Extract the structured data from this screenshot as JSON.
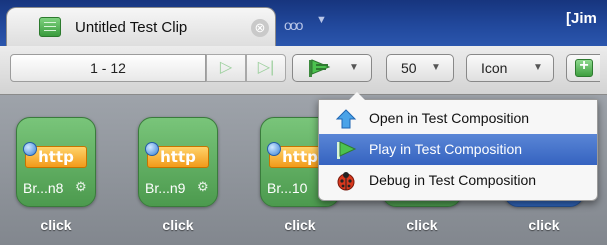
{
  "titlebar": {
    "tab_title": "Untitled Test Clip",
    "close_glyph": "⊗",
    "more_glyph": "ooo",
    "more_arrow": "▼",
    "user": "[Jim"
  },
  "toolbar": {
    "range": "1 - 12",
    "play_glyph": "▷",
    "last_glyph": "▷|",
    "dropdown_arrow": "▼",
    "count_value": "50",
    "view_value": "Icon"
  },
  "tiles": [
    {
      "badge": "http",
      "name": "Br...n8",
      "caption": "click"
    },
    {
      "badge": "http",
      "name": "Br...n9",
      "caption": "click"
    },
    {
      "badge": "http",
      "name": "Br...10",
      "caption": "click"
    },
    {
      "badge": "",
      "name": "",
      "caption": "click"
    },
    {
      "badge": "",
      "name": "",
      "caption": "click"
    }
  ],
  "menu": {
    "items": [
      {
        "label": "Open in Test Composition",
        "icon": "open-arrow-icon"
      },
      {
        "label": "Play in Test Composition",
        "icon": "play-flag-icon",
        "selected": true
      },
      {
        "label": "Debug in Test Composition",
        "icon": "ladybug-icon"
      }
    ]
  },
  "colors": {
    "titlebar_blue": "#21489c",
    "tile_green": "#5fae60",
    "menu_highlight": "#4672cc",
    "http_orange": "#f29a1a"
  }
}
